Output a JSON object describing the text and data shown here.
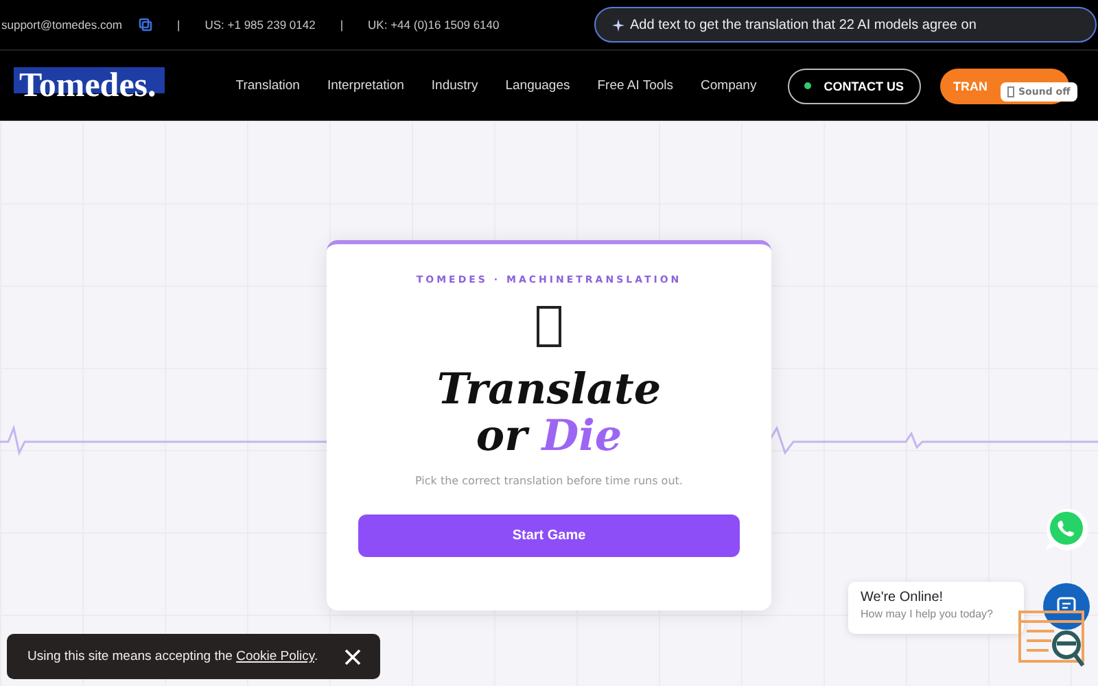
{
  "top_bar": {
    "email": "support@tomedes.com",
    "separators": [
      "|",
      "|"
    ],
    "phone_us": "US: +1 985 239 0142",
    "phone_uk": "UK: +44 (0)16 1509 6140",
    "ai_prompt": "Add text to get the translation that 22 AI models agree on"
  },
  "nav": {
    "logo": "Tomedes.",
    "items": [
      "Translation",
      "Interpretation",
      "Industry",
      "Languages",
      "Free AI Tools",
      "Company"
    ],
    "contact_button": "CONTACT US",
    "cta_button": "TRAN",
    "sound_badge": "Sound off"
  },
  "card": {
    "eyebrow": "TOMEDES · MACHINETRANSLATION",
    "title_line1": "Translate",
    "title_line2_plain": "or",
    "title_line2_accent": "Die",
    "subtitle": "Pick the correct translation before time runs out.",
    "start_button": "Start Game"
  },
  "chat": {
    "title": "We're Online!",
    "subtitle": "How may I help you today?"
  },
  "cookie": {
    "text": "Using this site means accepting the",
    "link": "Cookie Policy",
    "after": "."
  }
}
